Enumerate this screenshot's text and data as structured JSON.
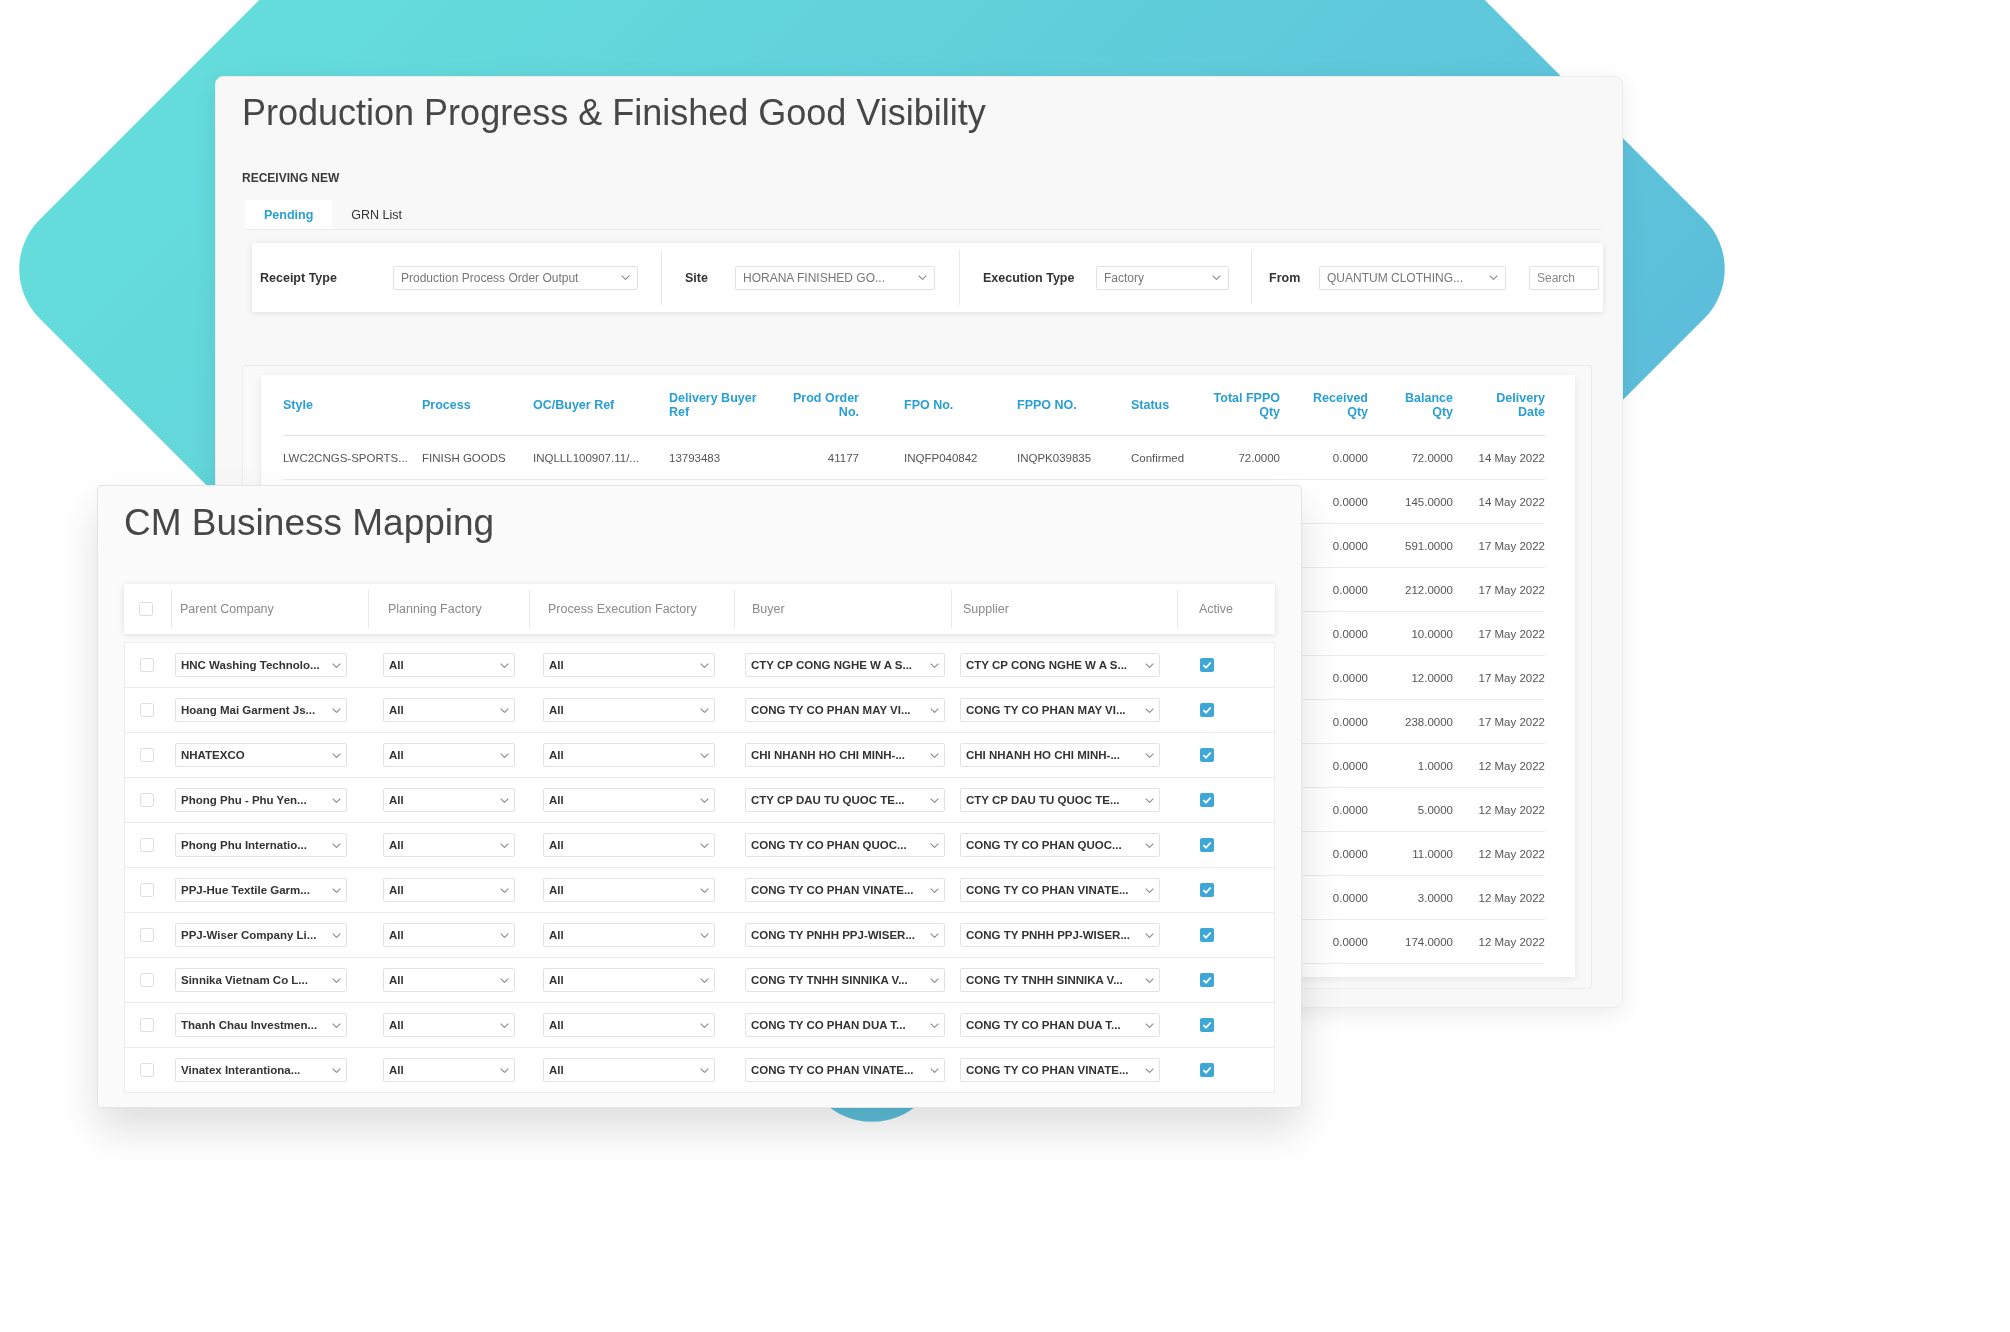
{
  "background_window": {
    "title": "Production Progress & Finished Good Visibility",
    "section": "RECEIVING NEW",
    "tabs": [
      {
        "label": "Pending",
        "selected": true
      },
      {
        "label": "GRN List",
        "selected": false
      }
    ],
    "filters": [
      {
        "label": "Receipt Type",
        "value": "Production Process Order Output"
      },
      {
        "label": "Site",
        "value": "HORANA FINISHED GO..."
      },
      {
        "label": "Execution Type",
        "value": "Factory"
      },
      {
        "label": "From",
        "value": "QUANTUM CLOTHING..."
      }
    ],
    "search": {
      "placeholder": "Search"
    },
    "table": {
      "columns": [
        "Style",
        "Process",
        "OC/Buyer Ref",
        "Delivery Buyer Ref",
        "Prod Order No.",
        "FPO No.",
        "FPPO NO.",
        "Status",
        "Total FPPO Qty",
        "Received Qty",
        "Balance Qty",
        "Delivery Date"
      ],
      "rows": [
        {
          "cells": [
            "LWC2CNGS-SPORTS...",
            "FINISH GOODS",
            "INQLLL100907.11/...",
            "13793483",
            "41177",
            "INQFP040842",
            "INQPK039835",
            "Confirmed",
            "72.0000",
            "0.0000",
            "72.0000",
            "14 May 2022"
          ]
        },
        {
          "cells": [
            "0.0000",
            "145.0000",
            "14 May 2022"
          ]
        },
        {
          "cells": [
            "0.0000",
            "591.0000",
            "17 May 2022"
          ]
        },
        {
          "cells": [
            "0.0000",
            "212.0000",
            "17 May 2022"
          ]
        },
        {
          "cells": [
            "0.0000",
            "10.0000",
            "17 May 2022"
          ]
        },
        {
          "cells": [
            "0.0000",
            "12.0000",
            "17 May 2022"
          ]
        },
        {
          "cells": [
            "0.0000",
            "238.0000",
            "17 May 2022"
          ]
        },
        {
          "cells": [
            "0.0000",
            "1.0000",
            "12 May 2022"
          ]
        },
        {
          "cells": [
            "0.0000",
            "5.0000",
            "12 May 2022"
          ]
        },
        {
          "cells": [
            "0.0000",
            "11.0000",
            "12 May 2022"
          ]
        },
        {
          "cells": [
            "0.0000",
            "3.0000",
            "12 May 2022"
          ]
        },
        {
          "cells": [
            "0.0000",
            "174.0000",
            "12 May 2022"
          ]
        }
      ]
    }
  },
  "foreground_window": {
    "title": "CM Business Mapping",
    "table": {
      "select_all": {
        "checked": false
      },
      "columns": [
        "Parent Company",
        "Planning Factory",
        "Process Execution Factory",
        "Buyer",
        "Supplier",
        "Active"
      ],
      "rows": [
        {
          "checked": false,
          "parent_company": "HNC Washing Technolo...",
          "planning_factory": "All",
          "process_execution_factory": "All",
          "buyer": "CTY CP CONG NGHE W A S...",
          "supplier": "CTY CP CONG NGHE W A S...",
          "active": true
        },
        {
          "checked": false,
          "parent_company": "Hoang Mai Garment Js...",
          "planning_factory": "All",
          "process_execution_factory": "All",
          "buyer": "CONG TY CO PHAN MAY VI...",
          "supplier": "CONG TY CO PHAN MAY VI...",
          "active": true
        },
        {
          "checked": false,
          "parent_company": "NHATEXCO",
          "planning_factory": "All",
          "process_execution_factory": "All",
          "buyer": "CHI NHANH HO CHI MINH-...",
          "supplier": "CHI NHANH HO CHI MINH-...",
          "active": true
        },
        {
          "checked": false,
          "parent_company": "Phong Phu - Phu Yen...",
          "planning_factory": "All",
          "process_execution_factory": "All",
          "buyer": "CTY CP DAU TU QUOC TE...",
          "supplier": "CTY CP DAU TU QUOC TE...",
          "active": true
        },
        {
          "checked": false,
          "parent_company": "Phong Phu Internatio...",
          "planning_factory": "All",
          "process_execution_factory": "All",
          "buyer": "CONG TY CO PHAN QUOC...",
          "supplier": "CONG TY CO PHAN QUOC...",
          "active": true
        },
        {
          "checked": false,
          "parent_company": "PPJ-Hue Textile Garm...",
          "planning_factory": "All",
          "process_execution_factory": "All",
          "buyer": "CONG TY CO PHAN VINATE...",
          "supplier": "CONG TY CO PHAN VINATE...",
          "active": true
        },
        {
          "checked": false,
          "parent_company": "PPJ-Wiser Company Li...",
          "planning_factory": "All",
          "process_execution_factory": "All",
          "buyer": "CONG TY PNHH PPJ-WISER...",
          "supplier": "CONG TY PNHH PPJ-WISER...",
          "active": true
        },
        {
          "checked": false,
          "parent_company": "Sinnika Vietnam Co L...",
          "planning_factory": "All",
          "process_execution_factory": "All",
          "buyer": "CONG TY TNHH SINNIKA V...",
          "supplier": "CONG TY TNHH SINNIKA V...",
          "active": true
        },
        {
          "checked": false,
          "parent_company": "Thanh Chau Investmen...",
          "planning_factory": "All",
          "process_execution_factory": "All",
          "buyer": "CONG TY CO PHAN DUA T...",
          "supplier": "CONG TY CO PHAN DUA T...",
          "active": true
        },
        {
          "checked": false,
          "parent_company": "Vinatex Interantiona...",
          "planning_factory": "All",
          "process_execution_factory": "All",
          "buyer": "CONG TY CO PHAN VINATE...",
          "supplier": "CONG TY CO PHAN VINATE...",
          "active": true
        }
      ]
    }
  }
}
